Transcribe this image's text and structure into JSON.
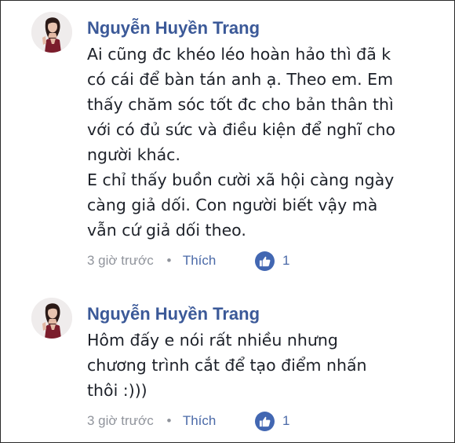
{
  "comments": [
    {
      "author": "Nguyễn Huyền Trang",
      "lines": [
        "Ai cũng đc khéo léo hoàn hảo thì đã k",
        "có cái để bàn tán anh ạ. Theo em. Em",
        "thấy chăm sóc tốt đc cho bản thân thì",
        "với có đủ sức và điều kiện để nghĩ cho",
        "người khác.",
        "E chỉ thấy buồn cười xã hội càng ngày",
        "càng giả dối. Con người biết vậy mà",
        "vẫn cứ giả dối theo."
      ],
      "time": "3 giờ trước",
      "separator": "•",
      "like_label": "Thích",
      "like_count": "1"
    },
    {
      "author": "Nguyễn Huyền Trang",
      "lines": [
        "Hôm đấy e nói rất nhiều nhưng",
        "chương trình cắt để tạo điểm nhấn",
        "thôi :)))"
      ],
      "time": "3 giờ trước",
      "separator": "•",
      "like_label": "Thích",
      "like_count": "1"
    }
  ],
  "colors": {
    "author": "#3b5998",
    "text": "#1d2129",
    "meta": "#90949c",
    "like_link": "#4b6aa8",
    "like_badge": "#4267b2"
  },
  "icons": {
    "avatar": "profile-photo",
    "like": "thumbs-up-icon"
  }
}
